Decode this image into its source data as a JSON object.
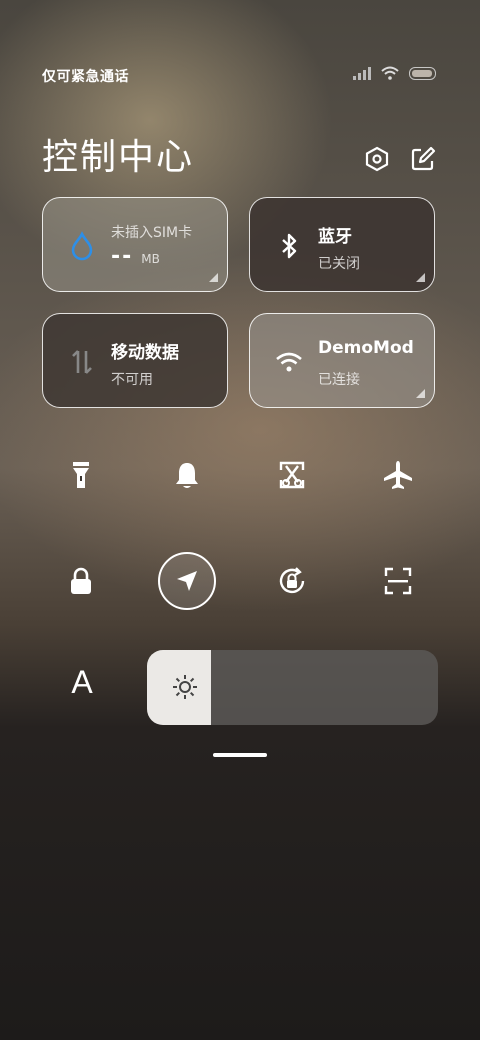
{
  "status_bar": {
    "carrier_text": "仅可紧急通话",
    "battery_level": 0.9
  },
  "header": {
    "title": "控制中心",
    "settings_icon": "hexagon-settings-icon",
    "edit_icon": "edit-icon"
  },
  "tiles": {
    "data_usage": {
      "title": "未插入SIM卡",
      "value": "--",
      "unit": "MB",
      "icon": "water-drop-icon"
    },
    "bluetooth": {
      "title": "蓝牙",
      "status": "已关闭",
      "icon": "bluetooth-icon"
    },
    "mobile_data": {
      "title": "移动数据",
      "status": "不可用",
      "icon": "data-arrows-icon"
    },
    "wifi": {
      "title": "DemoMod",
      "status": "已连接",
      "icon": "wifi-icon"
    }
  },
  "quick_toggles_row1": [
    "flashlight-icon",
    "bell-icon",
    "screenshot-scissors-icon",
    "airplane-icon"
  ],
  "quick_toggles_row2": [
    "lock-icon",
    "location-icon",
    "rotation-lock-icon",
    "scan-icon"
  ],
  "font_button_label": "A",
  "brightness": {
    "level": 0.22,
    "icon": "sun-icon"
  },
  "colors": {
    "accent_blue": "#2d8fe8"
  }
}
